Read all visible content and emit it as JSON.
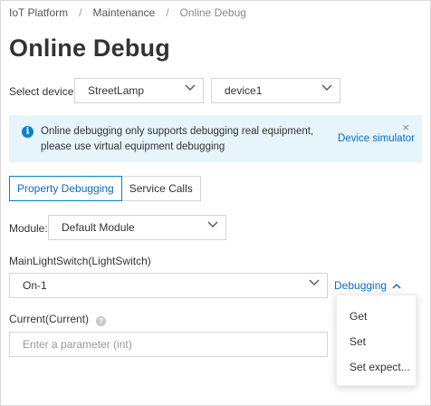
{
  "breadcrumb": {
    "items": [
      "IoT Platform",
      "Maintenance"
    ],
    "current": "Online Debug",
    "separator": "/"
  },
  "page_title": "Online Debug",
  "device_select": {
    "label": "Select device:",
    "product": "StreetLamp",
    "device": "device1"
  },
  "alert": {
    "icon": "info-icon",
    "message": "Online debugging only supports debugging real equipment, please use virtual equipment debugging",
    "link": "Device simulator",
    "close": "×"
  },
  "tabs": [
    {
      "label": "Property Debugging",
      "active": true
    },
    {
      "label": "Service Calls",
      "active": false
    }
  ],
  "module": {
    "label": "Module:",
    "value": "Default Module"
  },
  "main_light_switch": {
    "label": "MainLightSwitch(LightSwitch)",
    "value": "On-1"
  },
  "debugging_button": {
    "label": "Debugging"
  },
  "current": {
    "label": "Current(Current)",
    "help": "?",
    "placeholder": "Enter a parameter (int)"
  },
  "debug_menu": {
    "items": [
      "Get",
      "Set",
      "Set expect..."
    ]
  },
  "colors": {
    "accent": "#0a6cc2",
    "alert_bg": "#e6f4fc",
    "info_icon": "#0a80c8",
    "border": "#d4d4d4"
  }
}
